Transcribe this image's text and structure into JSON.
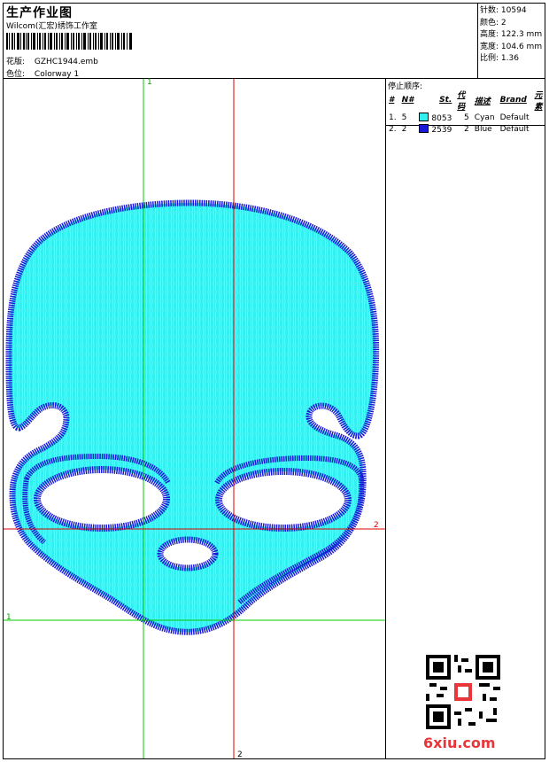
{
  "header": {
    "title": "生产作业图",
    "company": "Wilcom(汇宏)绣饰工作室",
    "design_label": "花版:",
    "design_file": "GZHC1944.emb",
    "colorway_label": "色位:",
    "colorway": "Colorway 1"
  },
  "stats": {
    "stitches_label": "针数:",
    "stitches": "10594",
    "colors_label": "颜色:",
    "colors": "2",
    "height_label": "高度:",
    "height": "122.3 mm",
    "width_label": "宽度:",
    "width": "104.6 mm",
    "scale_label": "比例:",
    "scale": "1.36"
  },
  "stop_sequence": {
    "heading": "停止顺序:",
    "columns": [
      "#",
      "N#",
      "St.",
      "代码",
      "描述",
      "Brand",
      "元素"
    ],
    "rows": [
      {
        "num": "1.",
        "needle": "5",
        "color": "#33f0f0",
        "stitches": "8053",
        "code": "5",
        "desc": "Cyan",
        "brand": "Default",
        "element": ""
      },
      {
        "num": "2.",
        "needle": "2",
        "color": "#1a1ad6",
        "stitches": "2539",
        "code": "2",
        "desc": "Blue",
        "brand": "Default",
        "element": ""
      }
    ]
  },
  "axes": {
    "green_label_top": "1",
    "green_label_left": "1",
    "red_label_right": "2",
    "red_label_bottom": "2"
  },
  "colors": {
    "fill": "#33f0f0",
    "outline": "#1a1ad6",
    "green_axis": "#00cc00",
    "red_axis": "#dd0000"
  },
  "watermark": "6xiu.com"
}
